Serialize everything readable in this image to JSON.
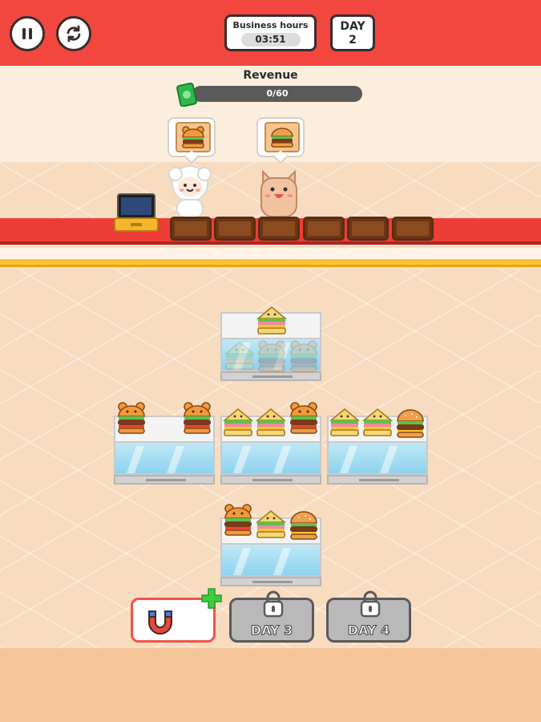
{
  "business_hours": {
    "label": "Business hours",
    "value": "03:51"
  },
  "day": {
    "label": "DAY",
    "value": "2"
  },
  "revenue": {
    "label": "Revenue",
    "value": "0/60",
    "progress": 0
  },
  "controls": {
    "pause_icon": "pause-icon",
    "restart_icon": "restart-icon"
  },
  "customers": [
    {
      "name": "sheep-customer",
      "order": "bear-burger"
    },
    {
      "name": "cat-customer",
      "order": "burger"
    }
  ],
  "tray_count": 6,
  "locked_buttons": [
    {
      "label": "DAY 3"
    },
    {
      "label": "DAY 4"
    }
  ],
  "powerup": {
    "icon": "magnet-icon",
    "add_icon": "plus-icon"
  },
  "colors": {
    "primary_red": "#f2473f",
    "floor": "#f7dcc0",
    "accent_yellow": "#f8c234",
    "green": "#3dcc3d"
  }
}
